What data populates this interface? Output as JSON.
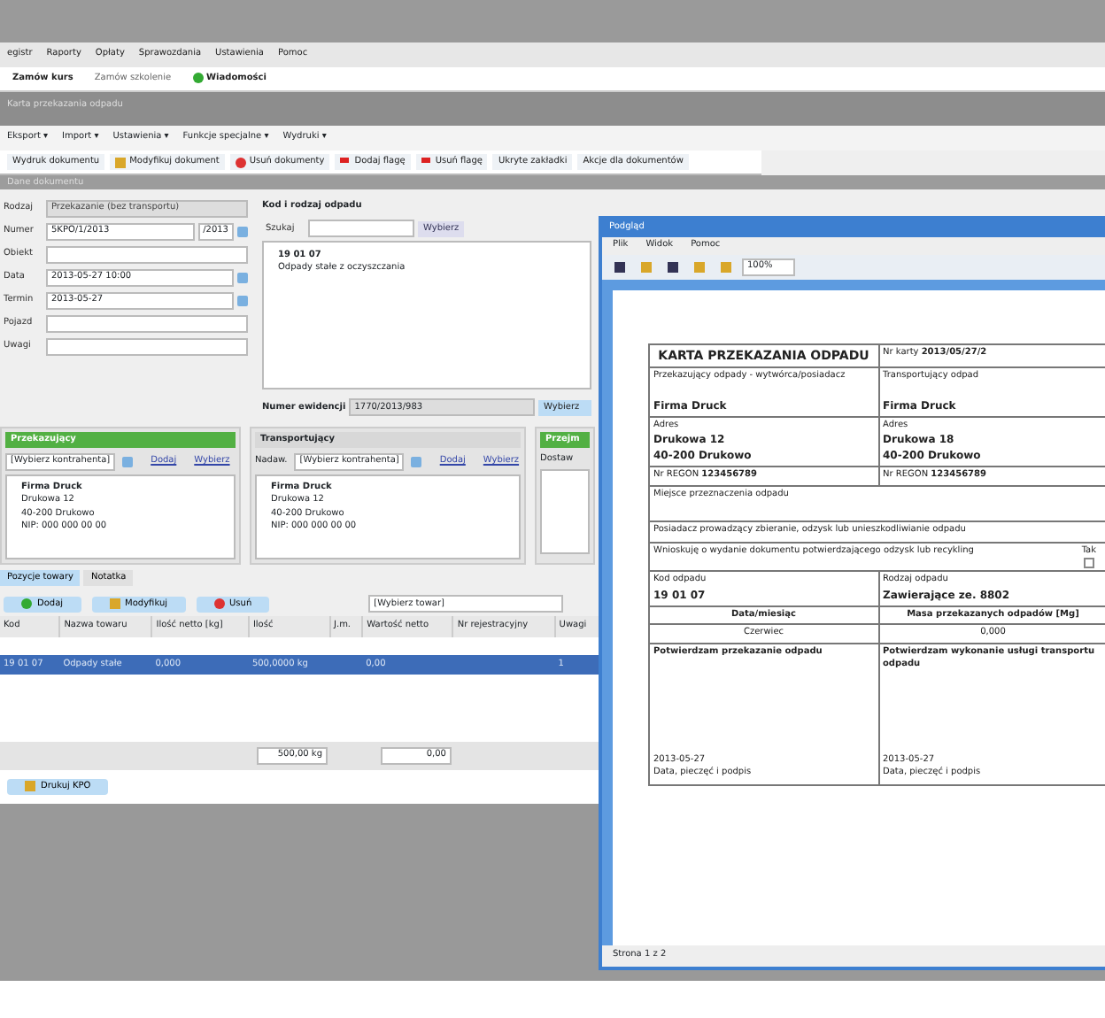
{
  "main_window": {
    "menu": [
      "egistr",
      "Raporty",
      "Opłaty",
      "Sprawozdania",
      "Ustawienia",
      "Pomoc"
    ],
    "quick_bar": [
      {
        "label": "Zamów kurs",
        "kind": "bold"
      },
      {
        "label": "Zamów szkolenie",
        "kind": "plain"
      },
      {
        "label": "Wiadomości",
        "kind": "green"
      }
    ],
    "title": "Karta przekazania odpadu",
    "submenu": [
      "Eksport ▾",
      "Import ▾",
      "Ustawienia ▾",
      "Funkcje specjalne ▾",
      "Wydruki ▾"
    ],
    "toolbar": [
      {
        "label": "Wydruk dokumentu",
        "kind": "plain"
      },
      {
        "label": "Modyfikuj dokument",
        "kind": "edit"
      },
      {
        "label": "Usuń dokumenty",
        "kind": "remove"
      },
      {
        "label": "Dodaj flagę",
        "kind": "flag"
      },
      {
        "label": "Usuń flagę",
        "kind": "flag"
      },
      {
        "label": "Ukryte zakładki",
        "kind": "plain"
      },
      {
        "label": "Akcje dla dokumentów",
        "kind": "plain"
      }
    ],
    "form_title": "Dane dokumentu",
    "fields": [
      {
        "label": "Rodzaj",
        "value": "Przekazanie (bez transportu)",
        "kind": "disabled"
      },
      {
        "label": "Numer",
        "value": "5KPO/1/2013",
        "kind": "number"
      },
      {
        "label": "Obiekt",
        "kind": "text"
      },
      {
        "label": "Data",
        "value": "2013-05-27 10:00",
        "kind": "date"
      },
      {
        "label": "Termin",
        "value": "2013-05-27",
        "kind": "date"
      },
      {
        "label": "Pojazd",
        "kind": "text"
      },
      {
        "label": "Uwagi",
        "kind": "text"
      }
    ],
    "number_suffix": "/2013",
    "waste": {
      "title": "Kod i rodzaj odpadu",
      "search_label": "Szukaj",
      "search_button": "Wybierz",
      "code": "19 01 07",
      "name": "Odpady stałe z oczyszczania",
      "card_label": "Numer ewidencji",
      "card_value": "1770/2013/983",
      "card_button": "Wybierz"
    },
    "parties": [
      {
        "title": "Przekazujący",
        "kind": "accent",
        "select": "[Wybierz kontrahenta]",
        "links": [
          "Dodaj",
          "Wybierz"
        ],
        "lines": [
          "Firma Druck",
          "Drukowa 12",
          "40-200 Drukowo",
          "NIP: 000 000 00 00"
        ]
      },
      {
        "title": "Transportujący",
        "kind": "plain",
        "label": "Nadaw.",
        "select": "[Wybierz kontrahenta]",
        "links": [
          "Dodaj",
          "Wybierz"
        ],
        "lines": [
          "Firma Druck",
          "Drukowa 12",
          "40-200 Drukowo",
          "NIP: 000 000 00 00"
        ]
      },
      {
        "title": "Przejm",
        "kind": "accent",
        "label": "Dostaw"
      }
    ],
    "tabs": [
      {
        "label": "Pozycje towary",
        "selected": true
      },
      {
        "label": "Notatka",
        "selected": false
      }
    ],
    "item_buttons": [
      {
        "label": "Dodaj",
        "kind": "add"
      },
      {
        "label": "Modyfikuj",
        "kind": "edit"
      },
      {
        "label": "Usuń",
        "kind": "remove"
      }
    ],
    "item_select": "[Wybierz towar]",
    "table": {
      "columns": [
        "Kod",
        "Nazwa towaru",
        "Ilość netto [kg]",
        "Ilość",
        "J.m.",
        "Wartość netto",
        "Nr rejestracyjny",
        "Uwagi"
      ],
      "rows": [
        {
          "selected": true,
          "cells": [
            "19 01 07",
            "Odpady stałe",
            "0,000",
            "500,0000 kg",
            "",
            "0,00",
            "",
            "1"
          ]
        }
      ],
      "totals": [
        "500,00 kg",
        "0,00"
      ]
    },
    "print_button": "Drukuj KPO"
  },
  "preview": {
    "title": "Podgląd",
    "menu": [
      "Plik",
      "Widok",
      "Pomoc"
    ],
    "zoom": "100%",
    "doc": {
      "title": "KARTA PRZEKAZANIA ODPADU",
      "number_label": "Nr karty",
      "number": "2013/05/27/2",
      "parties": [
        {
          "label": "Przekazujący odpady - wytwórca/posiadacz",
          "name": "Firma Druck",
          "address_label": "Adres",
          "street": "Drukowa 12",
          "city": "40-200 Drukowo",
          "regon_label": "Nr REGON",
          "regon": "123456789"
        },
        {
          "label": "Transportujący odpad",
          "name": "Firma Druck",
          "address_label": "Adres",
          "street": "Drukowa 18",
          "city": "40-200 Drukowo",
          "regon_label": "Nr REGON",
          "regon": "123456789"
        }
      ],
      "rows": [
        "Miejsce przeznaczenia odpadu",
        "Posiadacz prowadzący zbieranie, odzysk lub unieszkodliwianie odpadu",
        "Wnioskuję o wydanie dokumentu potwierdzającego odzysk lub recykling"
      ],
      "checkbox_label": "Tak",
      "checkbox_checked": false,
      "code_label": "Kod odpadu",
      "code": "19 01 07",
      "kind_label": "Rodzaj odpadu",
      "kind": "Zawierające ze. 8802",
      "month_label": "Data/miesiąc",
      "mass_label": "Masa przekazanych odpadów [Mg]",
      "month": "Czerwiec",
      "mass": "0,000",
      "confirm": [
        "Potwierdzam przekazanie odpadu",
        "Potwierdzam wykonanie usługi transportu odpadu"
      ],
      "dates": [
        "2013-05-27",
        "2013-05-27"
      ],
      "sign": [
        "Data, pieczęć i podpis",
        "Data, pieczęć i podpis"
      ]
    },
    "status": "Strona 1 z 2"
  }
}
